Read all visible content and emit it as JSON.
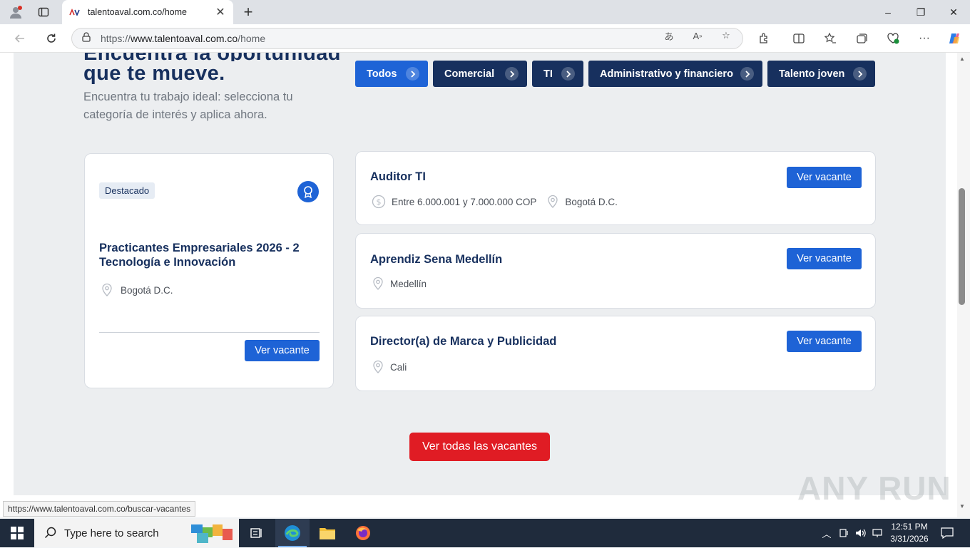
{
  "browser": {
    "tab": {
      "title": "talentoaval.com.co/home",
      "close": "✕"
    },
    "new_tab": "+",
    "url": {
      "prefix": "https://",
      "host": "www.talentoaval.com.co",
      "path": "/home"
    },
    "window_controls": {
      "minimize": "–",
      "maximize": "❐",
      "close": "✕"
    },
    "status_url": "https://www.talentoaval.com.co/buscar-vacantes"
  },
  "hero": {
    "title_line1": "Encuentra la oportunidad",
    "title_line2": "que te mueve.",
    "subtitle": "Encuentra tu trabajo ideal: selecciona tu categoría de interés y aplica ahora."
  },
  "categories": [
    {
      "label": "Todos",
      "active": true
    },
    {
      "label": "Comercial",
      "active": false
    },
    {
      "label": "TI",
      "active": false
    },
    {
      "label": "Administrativo y financiero",
      "active": false
    },
    {
      "label": "Talento joven",
      "active": false
    }
  ],
  "featured": {
    "badge": "Destacado",
    "title": "Practicantes Empresariales 2026 - 2 Tecnología e Innovación",
    "location": "Bogotá D.C.",
    "button": "Ver vacante"
  },
  "jobs": [
    {
      "title": "Auditor TI",
      "salary": "Entre 6.000.001 y 7.000.000 COP",
      "location": "Bogotá D.C.",
      "button": "Ver vacante"
    },
    {
      "title": "Aprendiz Sena Medellín",
      "location": "Medellín",
      "button": "Ver vacante"
    },
    {
      "title": "Director(a) de Marca y Publicidad",
      "location": "Cali",
      "button": "Ver vacante"
    }
  ],
  "all_button": "Ver todas las vacantes",
  "watermark": "ANY RUN",
  "taskbar": {
    "search_placeholder": "Type here to search",
    "time": "12:51 PM",
    "date": "3/31/2026"
  },
  "colors": {
    "navy": "#17305e",
    "blue": "#1e63d6",
    "red": "#e01c24"
  }
}
